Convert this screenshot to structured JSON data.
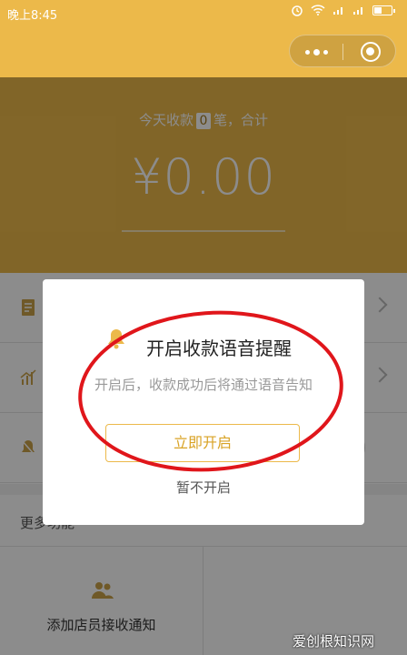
{
  "status_bar": {
    "time": "晚上8:45",
    "battery_pct": 0.4,
    "battery_label": ""
  },
  "summary": {
    "prefix": "今天收款",
    "count": "0",
    "suffix": "笔，合计"
  },
  "amount": "¥0.00",
  "more_section": {
    "title": "更多功能",
    "staff_notify_label": "添加店员接收通知"
  },
  "modal": {
    "title": "开启收款语音提醒",
    "description": "开启后，收款成功后将通过语音告知",
    "enable_button": "立即开启",
    "skip_link": "暂不开启"
  },
  "watermark": "爱创根知识网",
  "colors": {
    "brand": "#ecb94a",
    "annotation": "#e0161b"
  }
}
